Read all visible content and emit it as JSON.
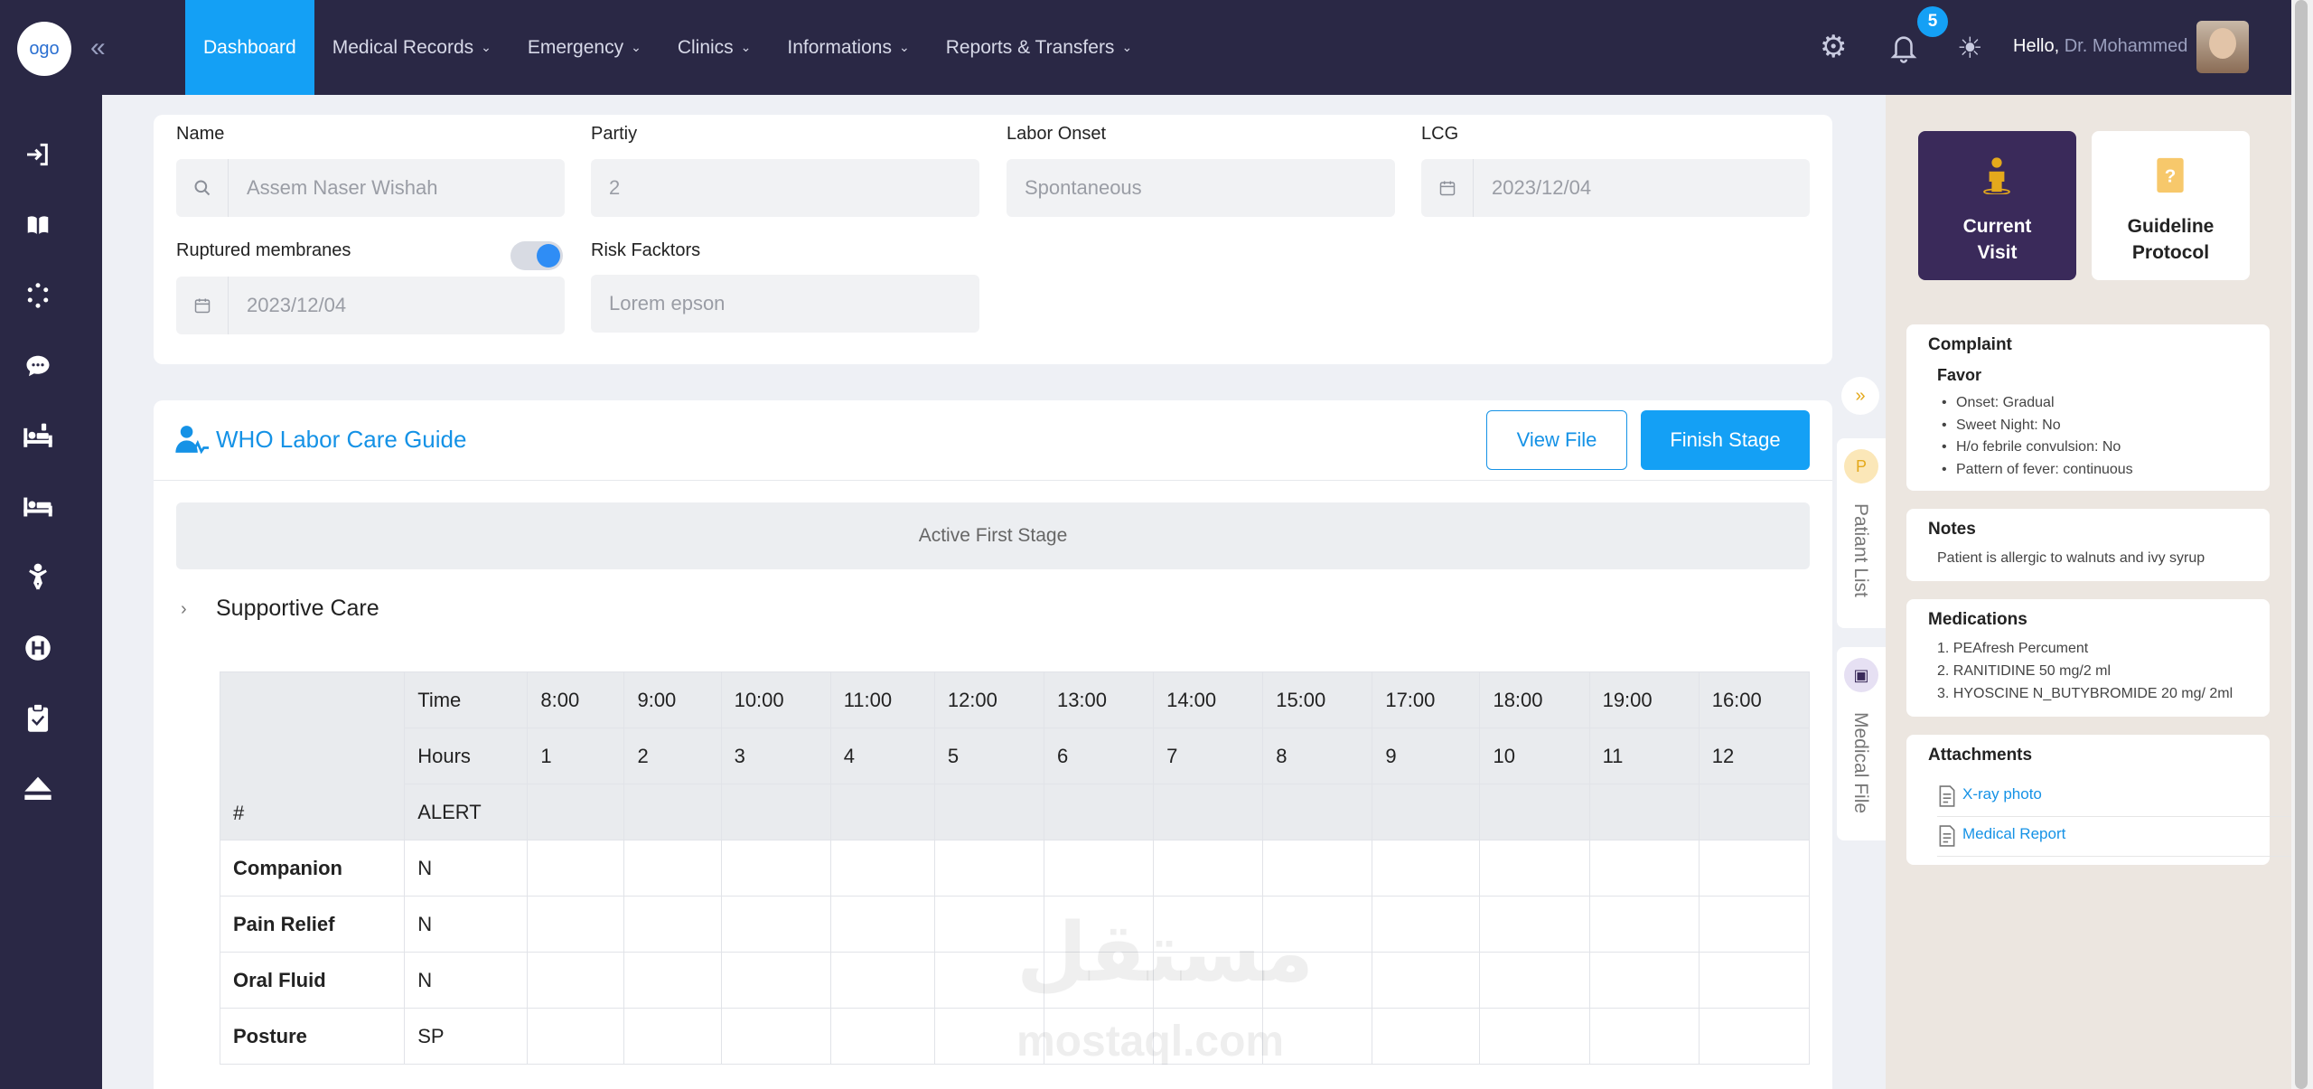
{
  "header": {
    "logo_text": "ogo",
    "nav": [
      {
        "label": "Dashboard",
        "active": true,
        "dropdown": false
      },
      {
        "label": "Medical Records",
        "active": false,
        "dropdown": true
      },
      {
        "label": "Emergency",
        "active": false,
        "dropdown": true
      },
      {
        "label": "Clinics",
        "active": false,
        "dropdown": true
      },
      {
        "label": "Informations",
        "active": false,
        "dropdown": true
      },
      {
        "label": "Reports & Transfers",
        "active": false,
        "dropdown": true
      }
    ],
    "notification_count": "5",
    "greeting": "Hello,",
    "user_name": "Dr. Mohammed"
  },
  "sidebar_icons": [
    "login-icon",
    "book-icon",
    "loader-icon",
    "chat-icon",
    "hospital-bed-icon",
    "bed-icon",
    "baby-icon",
    "hospital-h-icon",
    "clipboard-icon",
    "eject-icon"
  ],
  "patient_form": {
    "name_label": "Name",
    "name_value": "Assem Naser Wishah",
    "parity_label": "Partiy",
    "parity_value": "2",
    "labor_onset_label": "Labor Onset",
    "labor_onset_value": "Spontaneous",
    "lcg_label": "LCG",
    "lcg_value": "2023/12/04",
    "ruptured_label": "Ruptured membranes",
    "ruptured_value": "2023/12/04",
    "ruptured_toggle_on": true,
    "risk_label": "Risk Facktors",
    "risk_value": "Lorem epson"
  },
  "guide": {
    "title": "WHO Labor Care Guide",
    "view_file": "View File",
    "finish_stage": "Finish Stage",
    "stage": "Active First Stage",
    "section": "Supportive Care"
  },
  "table": {
    "time_label": "Time",
    "hours_label": "Hours",
    "alert_label": "ALERT",
    "hash_label": "#",
    "times": [
      "8:00",
      "9:00",
      "10:00",
      "11:00",
      "12:00",
      "13:00",
      "14:00",
      "15:00",
      "17:00",
      "18:00",
      "19:00",
      "16:00"
    ],
    "hours": [
      "1",
      "2",
      "3",
      "4",
      "5",
      "6",
      "7",
      "8",
      "9",
      "10",
      "11",
      "12"
    ],
    "rows": [
      {
        "label": "Companion",
        "alert": "N"
      },
      {
        "label": "Pain Relief",
        "alert": "N"
      },
      {
        "label": "Oral Fluid",
        "alert": "N"
      },
      {
        "label": "Posture",
        "alert": "SP"
      }
    ]
  },
  "side_tabs": {
    "patient_list": "Patiant List",
    "medical_file": "Medical File"
  },
  "right_panel": {
    "current_visit": [
      "Current",
      "Visit"
    ],
    "guideline_protocol": [
      "Guideline",
      "Protocol"
    ],
    "complaint_title": "Complaint",
    "complaint_sub": "Favor",
    "complaint_items": [
      "Onset: Gradual",
      "Sweet Night: No",
      "H/o febrile convulsion: No",
      "Pattern of fever: continuous"
    ],
    "notes_title": "Notes",
    "notes_text": "Patient is allergic to walnuts and ivy syrup",
    "medications_title": "Medications",
    "medications": [
      "1. PEAfresh Percument",
      "2. RANITIDINE 50 mg/2 ml",
      "3. HYOSCINE N_BUTYBROMIDE 20 mg/ 2ml"
    ],
    "attachments_title": "Attachments",
    "attachments": [
      "X-ray photo",
      "Medical Report"
    ]
  },
  "watermark": {
    "arabic": "مستقل",
    "latin": "mostaql.com"
  },
  "colors": {
    "primary": "#14a0f5",
    "sidebar": "#2a2845",
    "accent_tile": "#3a2a5a"
  }
}
